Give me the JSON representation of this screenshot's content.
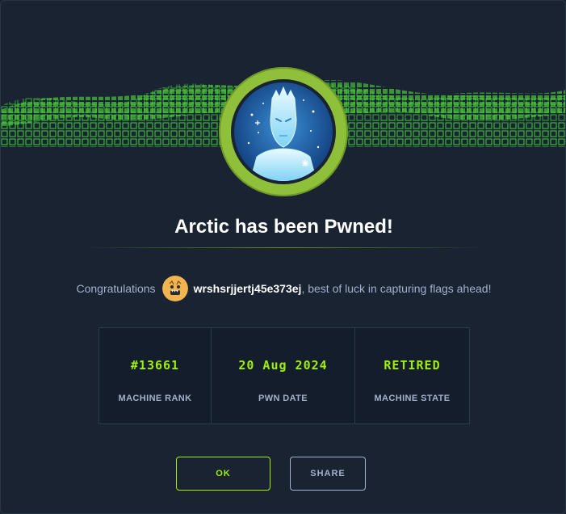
{
  "modal": {
    "title": "Arctic has been Pwned!",
    "avatar_icon": "ice-warrior-avatar",
    "congrats_prefix": "Congratulations",
    "username": "wrshsrjjertj45e373ej",
    "congrats_suffix": ", best of luck in capturing flags ahead!"
  },
  "stats": [
    {
      "value": "#13661",
      "label": "MACHINE RANK"
    },
    {
      "value": "20 Aug 2024",
      "label": "PWN DATE"
    },
    {
      "value": "RETIRED",
      "label": "MACHINE STATE"
    }
  ],
  "buttons": {
    "ok_label": "OK",
    "share_label": "SHARE"
  },
  "colors": {
    "background": "#1a2332",
    "accent": "#9fef00",
    "muted": "#a4b1cd",
    "ring": "#8fc03a"
  }
}
